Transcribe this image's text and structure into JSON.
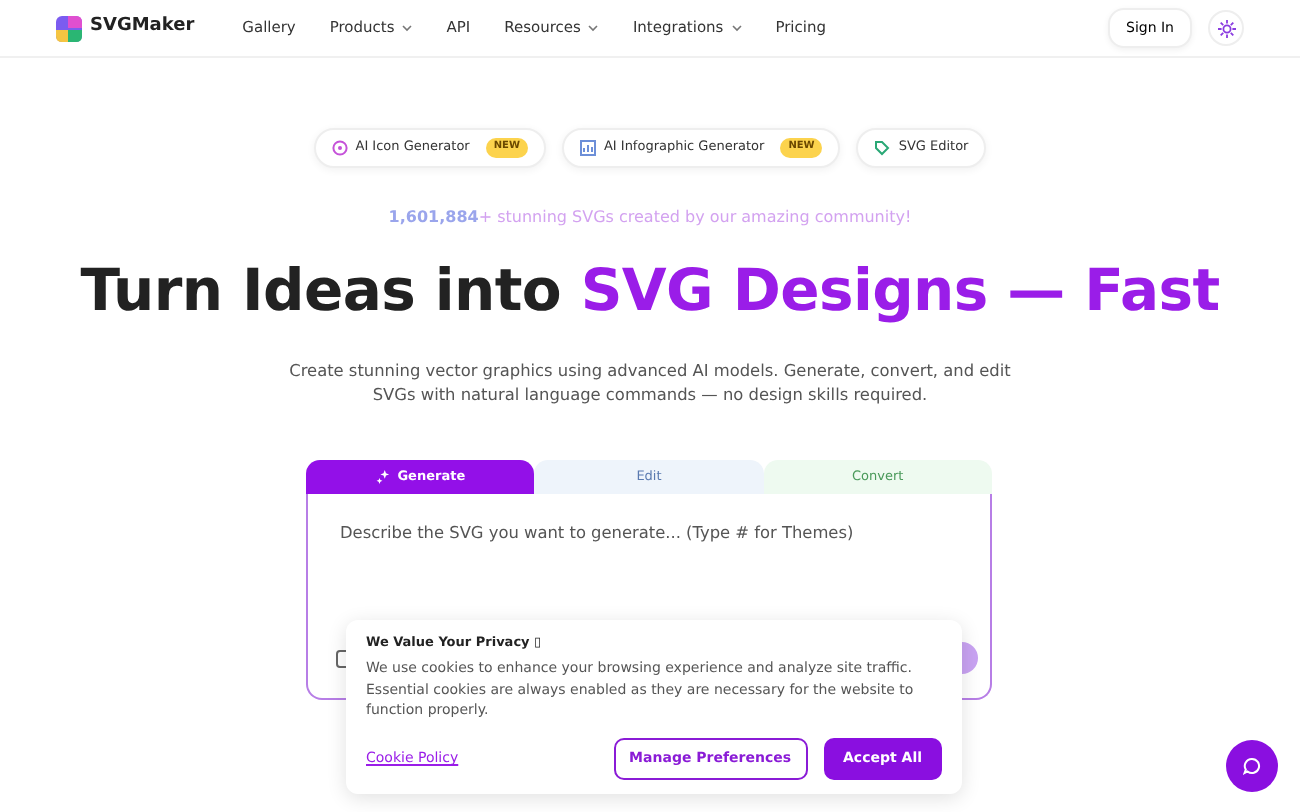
{
  "nav": {
    "brand": "SVGMaker",
    "items": [
      {
        "label": "Gallery",
        "dropdown": false
      },
      {
        "label": "Products",
        "dropdown": true
      },
      {
        "label": "API",
        "dropdown": false
      },
      {
        "label": "Resources",
        "dropdown": true
      },
      {
        "label": "Integrations",
        "dropdown": true
      },
      {
        "label": "Pricing",
        "dropdown": false
      }
    ],
    "sign_in": "Sign In"
  },
  "pills": [
    {
      "label": "AI Icon Generator",
      "badge": "NEW",
      "kind": "icon"
    },
    {
      "label": "AI Infographic Generator",
      "badge": "NEW",
      "kind": "infographic"
    },
    {
      "label": "SVG Editor",
      "kind": "editor"
    }
  ],
  "counter": {
    "number": "1,601,884",
    "text": "+ stunning SVGs created by our amazing community!"
  },
  "headline": {
    "lead": "Turn Ideas into",
    "accent": "SVG Designs — Fast"
  },
  "description": "Create stunning vector graphics using advanced AI models. Generate, convert, and edit SVGs with natural language commands — no design skills required.",
  "tabs": [
    {
      "label": "Generate",
      "selected": true
    },
    {
      "label": "Edit",
      "selected": false
    },
    {
      "label": "Convert",
      "selected": false
    }
  ],
  "prompt": {
    "placeholder": "Describe the SVG you want to generate... (Type # for Themes)"
  },
  "cookie": {
    "title": "We Value Your Privacy ▯",
    "text": "We use cookies to enhance your browsing experience and analyze site traffic. Essential cookies are always enabled as they are necessary for the website to function properly.",
    "link": "Cookie Policy",
    "buttons": [
      {
        "label": "Manage Preferences",
        "kind": "outline"
      },
      {
        "label": "Accept All",
        "kind": "primary"
      }
    ]
  }
}
